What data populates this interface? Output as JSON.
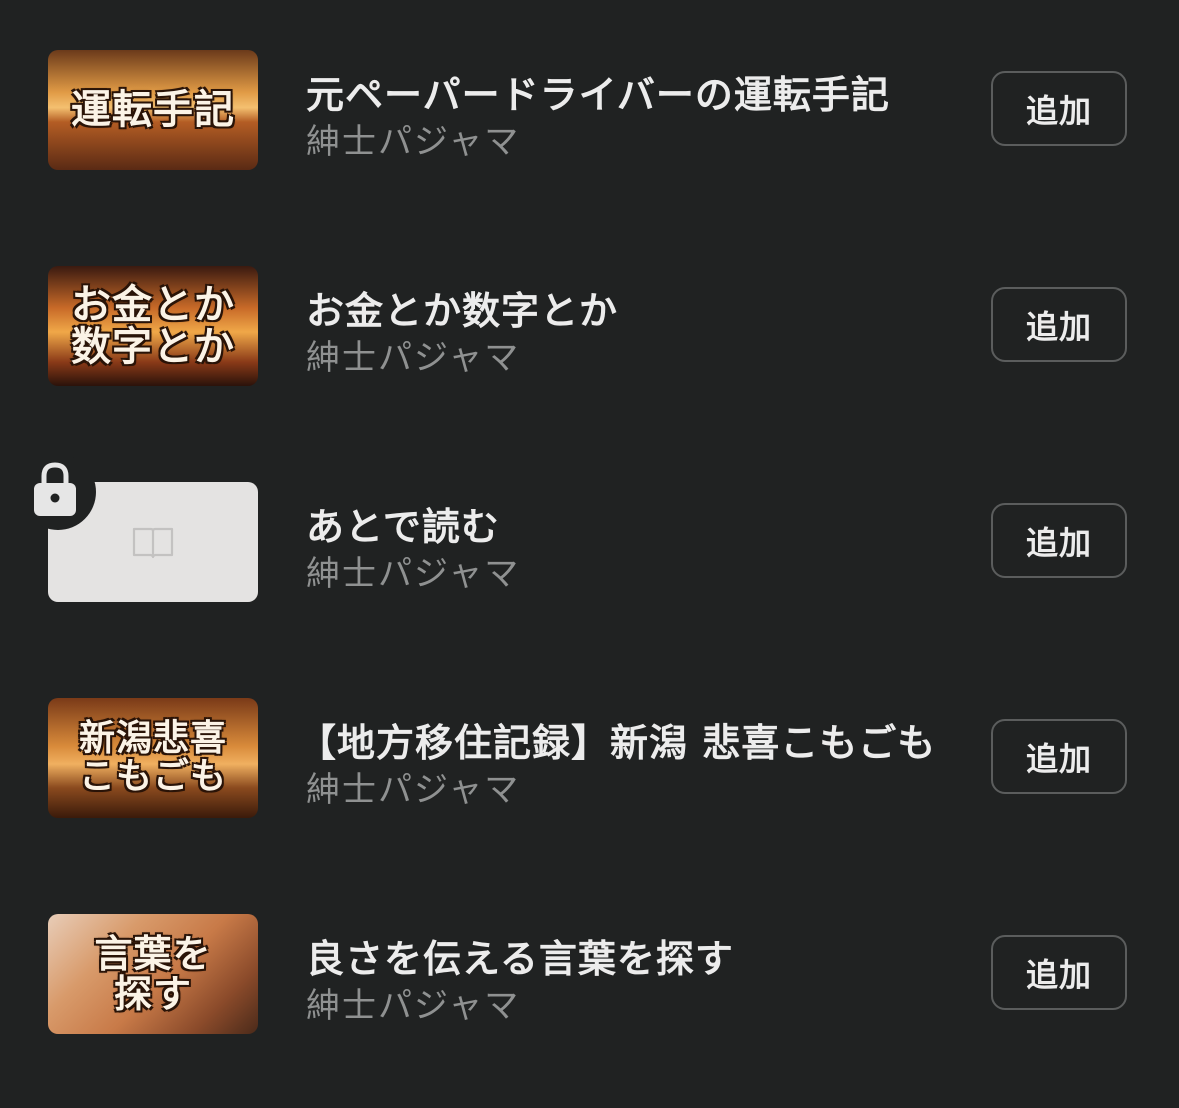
{
  "magazines": [
    {
      "title": "元ペーパードライバーの運転手記",
      "author": "紳士パジャマ",
      "thumbnail_text": "運転手記",
      "add_label": "追加"
    },
    {
      "title": "お金とか数字とか",
      "author": "紳士パジャマ",
      "thumbnail_text": "お金とか\n数字とか",
      "add_label": "追加"
    },
    {
      "title": "あとで読む",
      "author": "紳士パジャマ",
      "thumbnail_icon": "book-icon",
      "locked": true,
      "badge_icon": "lock-icon",
      "add_label": "追加"
    },
    {
      "title": "【地方移住記録】新潟 悲喜こもごも",
      "author": "紳士パジャマ",
      "thumbnail_text": "新潟悲喜\nこもごも",
      "add_label": "追加"
    },
    {
      "title": "良さを伝える言葉を探す",
      "author": "紳士パジャマ",
      "thumbnail_text": "言葉を\n探す",
      "add_label": "追加"
    }
  ],
  "colors": {
    "background": "#202222",
    "title_text": "#ececec",
    "author_text": "#8f9191",
    "button_border": "#5b5d5d",
    "placeholder_bg": "#e4e3e2"
  }
}
